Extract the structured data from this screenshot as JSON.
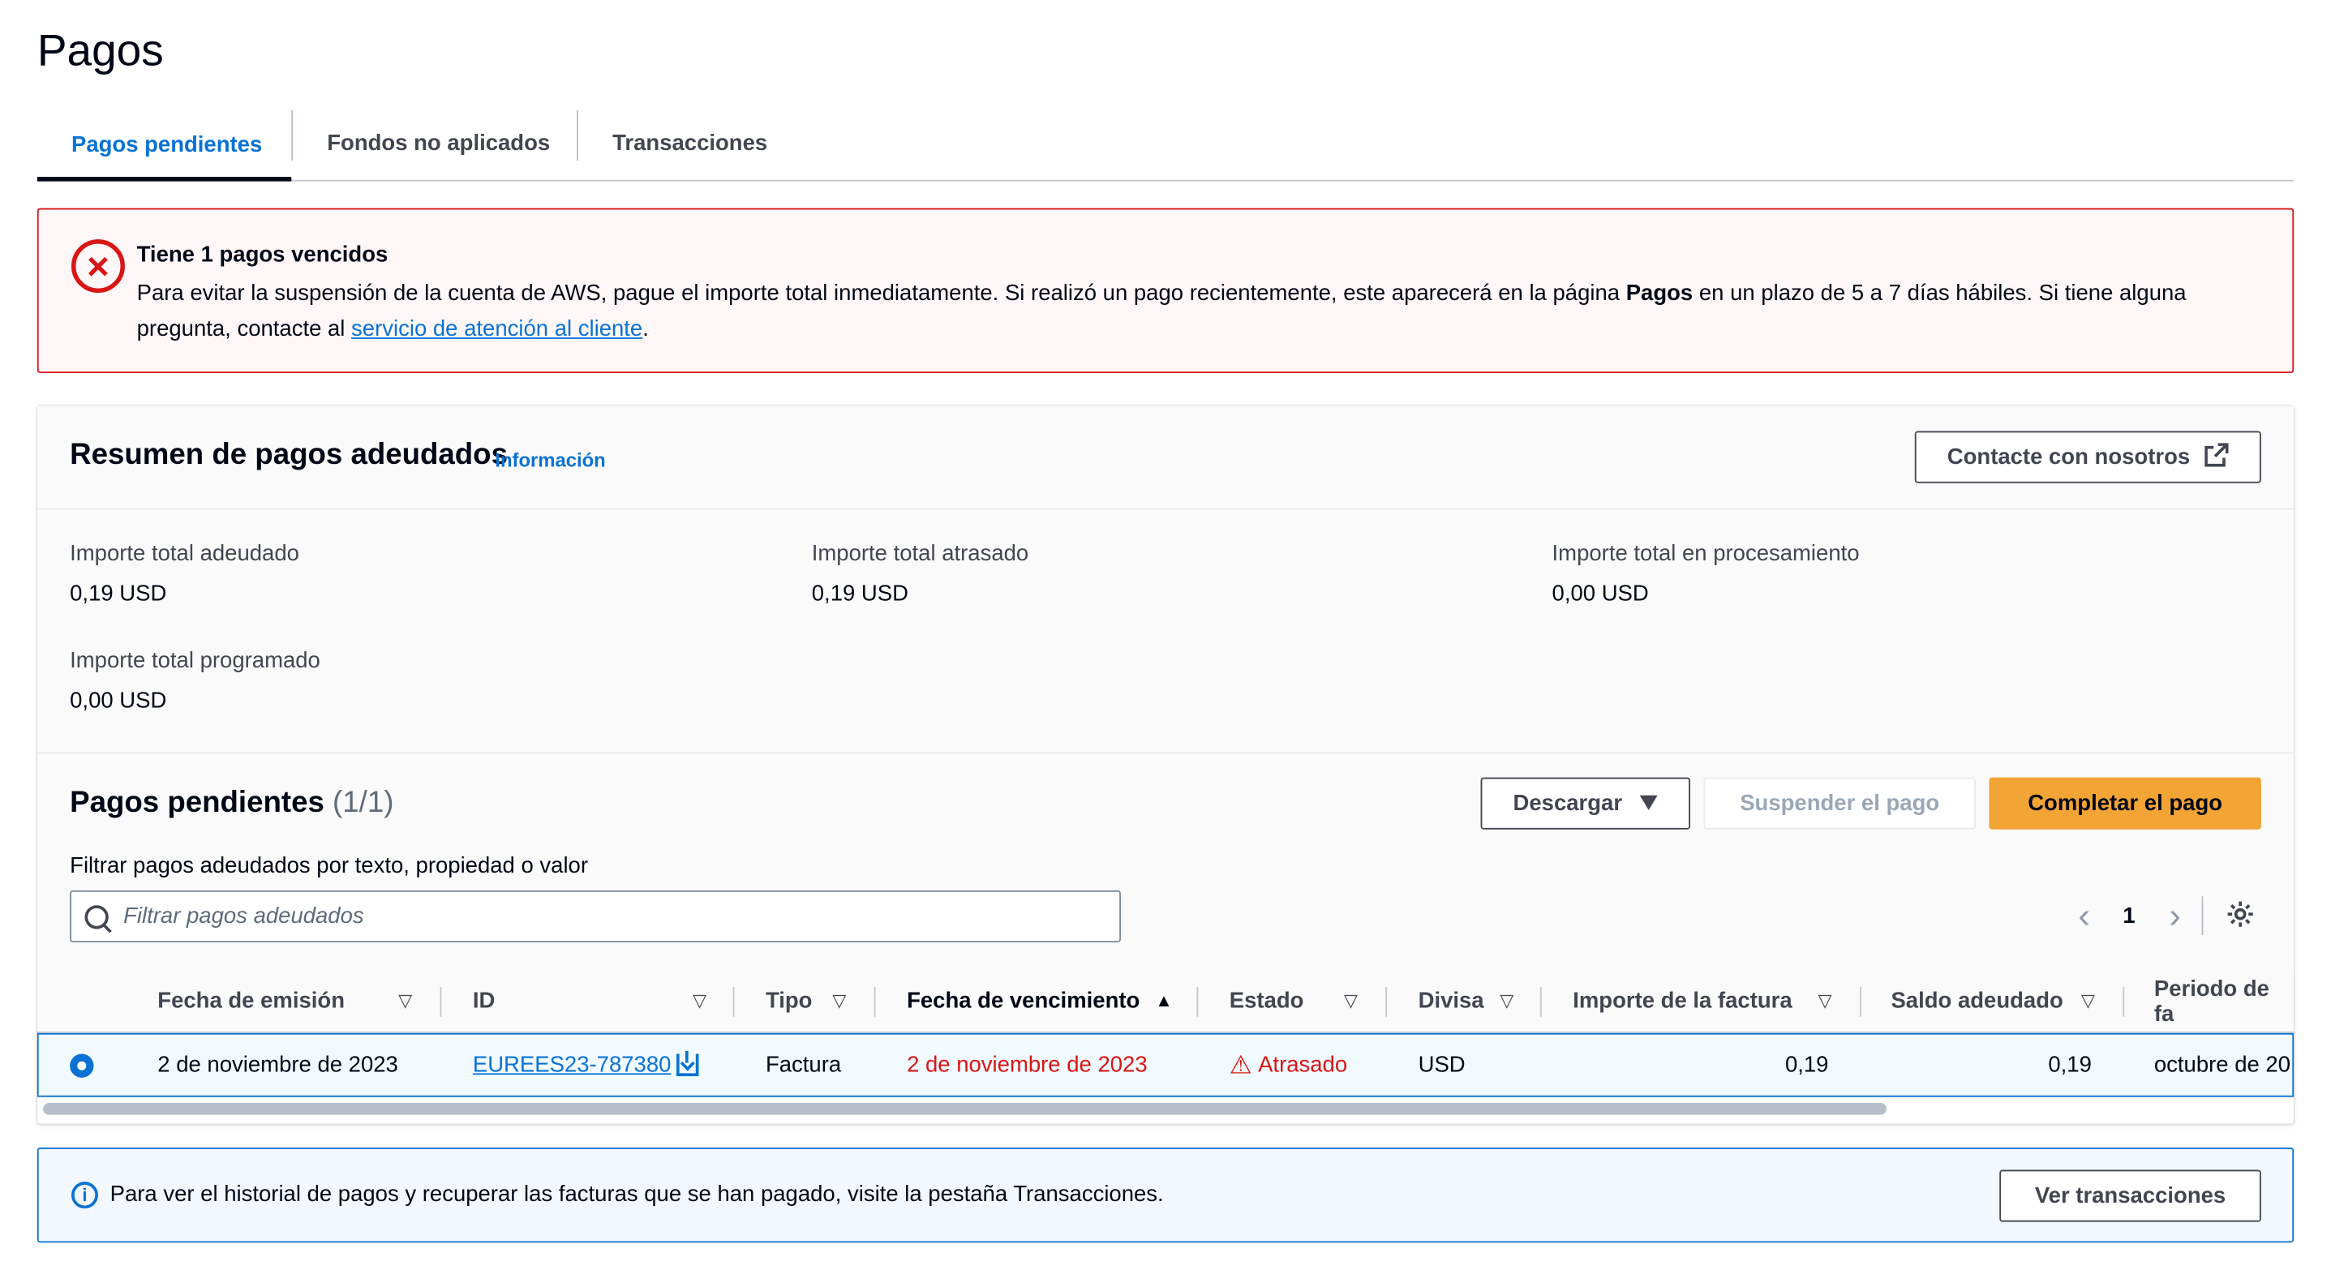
{
  "page": {
    "title": "Pagos"
  },
  "tabs": [
    {
      "label": "Pagos pendientes",
      "active": true
    },
    {
      "label": "Fondos no aplicados",
      "active": false
    },
    {
      "label": "Transacciones",
      "active": false
    }
  ],
  "alert": {
    "icon": "error-icon",
    "title": "Tiene 1 pagos vencidos",
    "body_1": "Para evitar la suspensión de la cuenta de AWS, pague el importe total inmediatamente. Si realizó un pago recientemente, este aparecerá en la página ",
    "body_bold": "Pagos",
    "body_2": " en un plazo de 5 a 7 días hábiles. Si tiene alguna pregunta, contacte al ",
    "link": "servicio de atención al cliente",
    "body_end": "."
  },
  "summary": {
    "title": "Resumen de pagos adeudados",
    "info_link": "Información",
    "contact_button": "Contacte con nosotros",
    "items": [
      {
        "label": "Importe total adeudado",
        "value": "0,19 USD"
      },
      {
        "label": "Importe total atrasado",
        "value": "0,19 USD"
      },
      {
        "label": "Importe total en procesamiento",
        "value": "0,00 USD"
      },
      {
        "label": "Importe total programado",
        "value": "0,00 USD"
      }
    ]
  },
  "pending": {
    "title": "Pagos pendientes",
    "count": "(1/1)",
    "download_button": "Descargar",
    "suspend_button": "Suspender el pago",
    "complete_button": "Completar el pago",
    "filter_label": "Filtrar pagos adeudados por texto, propiedad o valor",
    "filter_placeholder": "Filtrar pagos adeudados",
    "page_number": "1"
  },
  "table": {
    "columns": [
      "Fecha de emisión",
      "ID",
      "Tipo",
      "Fecha de vencimiento",
      "Estado",
      "Divisa",
      "Importe de la factura",
      "Saldo adeudado",
      "Periodo de fa"
    ],
    "rows": [
      {
        "fecha_emision": "2 de noviembre de 2023",
        "id": "EUREES23-787380",
        "tipo": "Factura",
        "fecha_vencimiento": "2 de noviembre de 2023",
        "estado": "Atrasado",
        "divisa": "USD",
        "importe": "0,19",
        "saldo": "0,19",
        "periodo": "octubre de 20"
      }
    ]
  },
  "info_alert": {
    "text": "Para ver el historial de pagos y recuperar las facturas que se han pagado, visite la pestaña Transacciones.",
    "button": "Ver transacciones"
  },
  "colors": {
    "accent": "#0972d3",
    "error": "#d91515",
    "primary_button": "#f2a434"
  }
}
